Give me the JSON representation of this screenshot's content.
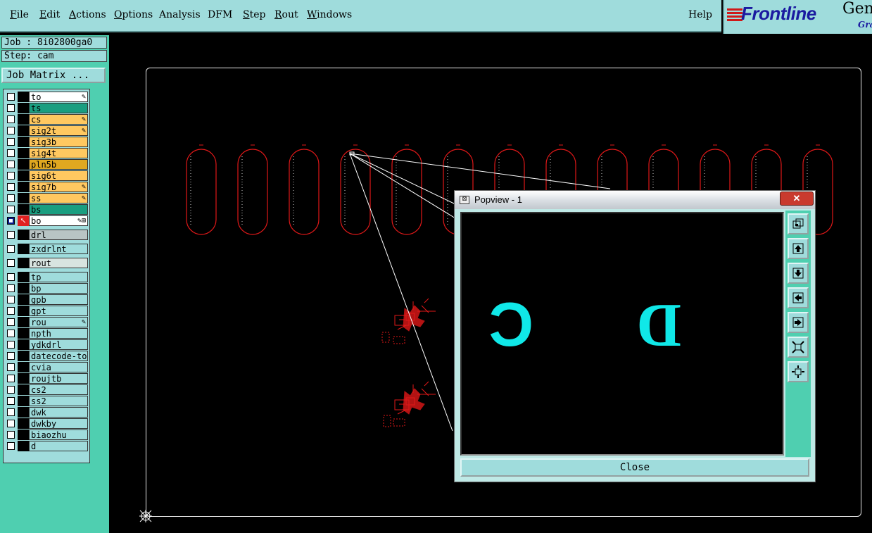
{
  "menu": {
    "file": {
      "first": "F",
      "rest": "ile"
    },
    "edit": {
      "first": "E",
      "rest": "dit"
    },
    "actions": {
      "first": "A",
      "rest": "ctions"
    },
    "options": {
      "first": "O",
      "rest": "ptions"
    },
    "analysis": {
      "first": "A",
      "rest": "nalysis"
    },
    "dfm": {
      "first": "D",
      "rest": "FM"
    },
    "step": {
      "first": "S",
      "rest": "tep"
    },
    "rout": {
      "first": "R",
      "rest": "out"
    },
    "windows": {
      "first": "W",
      "rest": "indows"
    },
    "help": "Help"
  },
  "logo": {
    "brand": "Frontline",
    "product": "Gen",
    "sub": "Gra"
  },
  "job": {
    "job_line": "Job : 8i02800ga0",
    "step_line": "Step: cam",
    "matrix_button": "Job Matrix ..."
  },
  "layers": [
    {
      "name": "to",
      "color": "#ffffff",
      "flag": "✎"
    },
    {
      "name": "ts",
      "color": "#1a9e80",
      "flag": ""
    },
    {
      "name": "cs",
      "color": "#ffc860",
      "flag": "✎"
    },
    {
      "name": "sig2t",
      "color": "#ffc860",
      "flag": "✎"
    },
    {
      "name": "sig3b",
      "color": "#ffc860",
      "flag": ""
    },
    {
      "name": "sig4t",
      "color": "#ffc860",
      "flag": ""
    },
    {
      "name": "pln5b",
      "color": "#e0a820",
      "flag": ""
    },
    {
      "name": "sig6t",
      "color": "#ffc860",
      "flag": ""
    },
    {
      "name": "sig7b",
      "color": "#ffc860",
      "flag": "✎"
    },
    {
      "name": "ss",
      "color": "#ffc860",
      "flag": "✎"
    },
    {
      "name": "bs",
      "color": "#1a9e80",
      "flag": ""
    },
    {
      "name": "bo",
      "color": "#ffffff",
      "flag": "✎⊞",
      "active": true
    },
    {
      "name": "drl",
      "color": "#b8c4c4",
      "flag": ""
    },
    {
      "name": "zxdrlnt",
      "color": "#9fdcdc",
      "flag": ""
    },
    {
      "name": "rout",
      "color": "#d8e4e0",
      "flag": ""
    },
    {
      "name": "tp",
      "color": "#9fdcdc",
      "flag": ""
    },
    {
      "name": "bp",
      "color": "#9fdcdc",
      "flag": ""
    },
    {
      "name": "gpb",
      "color": "#9fdcdc",
      "flag": ""
    },
    {
      "name": "gpt",
      "color": "#9fdcdc",
      "flag": ""
    },
    {
      "name": "rou",
      "color": "#9fdcdc",
      "flag": "✎"
    },
    {
      "name": "npth",
      "color": "#9fdcdc",
      "flag": ""
    },
    {
      "name": "ydkdrl",
      "color": "#9fdcdc",
      "flag": ""
    },
    {
      "name": "datecode-to",
      "color": "#9fdcdc",
      "flag": ""
    },
    {
      "name": "cvia",
      "color": "#9fdcdc",
      "flag": ""
    },
    {
      "name": "roujtb",
      "color": "#9fdcdc",
      "flag": ""
    },
    {
      "name": "cs2",
      "color": "#9fdcdc",
      "flag": ""
    },
    {
      "name": "ss2",
      "color": "#9fdcdc",
      "flag": ""
    },
    {
      "name": "dwk",
      "color": "#9fdcdc",
      "flag": ""
    },
    {
      "name": "dwkby",
      "color": "#9fdcdc",
      "flag": ""
    },
    {
      "name": "biaozhu",
      "color": "#9fdcdc",
      "flag": ""
    },
    {
      "name": "d",
      "color": "#9fdcdc",
      "flag": ""
    }
  ],
  "popview": {
    "title": "Popview - 1",
    "close_x": "✕",
    "glyph_left": "C",
    "glyph_right": "D",
    "close_button": "Close"
  },
  "colors": {
    "panel": "#9fdcdc",
    "panel_dark": "#4fcfb0",
    "trace": "#e01818",
    "glyph": "#10e8e8",
    "outline": "#e8e8e8"
  }
}
